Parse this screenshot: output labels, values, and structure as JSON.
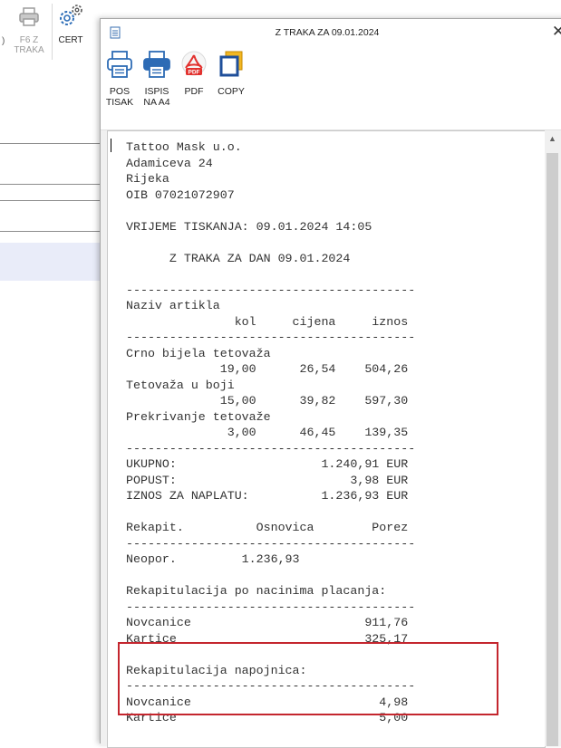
{
  "background_app": {
    "toolbar": {
      "cut_label": ")",
      "f6_label_line1": "F6 Z",
      "f6_label_line2": "TRAKA",
      "cert_label": "CERT"
    }
  },
  "window": {
    "title": "Z TRAKA ZA 09.01.2024",
    "close_glyph": "✕",
    "ribbon": {
      "pos_label_line1": "POS",
      "pos_label_line2": "TISAK",
      "ispis_label_line1": "ISPIS",
      "ispis_label_line2": "NA A4",
      "pdf_label": "PDF",
      "pdf_badge": "PDF",
      "copy_label": "COPY"
    }
  },
  "receipt": {
    "lines": [
      "Tattoo Mask u.o.",
      "Adamiceva 24",
      "Rijeka",
      "OIB 07021072907",
      "",
      "VRIJEME TISKANJA: 09.01.2024 14:05",
      "",
      "      Z TRAKA ZA DAN 09.01.2024",
      "",
      "----------------------------------------",
      "Naziv artikla",
      "               kol     cijena     iznos",
      "----------------------------------------",
      "Crno bijela tetovaža",
      "             19,00      26,54    504,26",
      "Tetovaža u boji",
      "             15,00      39,82    597,30",
      "Prekrivanje tetovaže",
      "              3,00      46,45    139,35",
      "----------------------------------------",
      "UKUPNO:                    1.240,91 EUR",
      "POPUST:                        3,98 EUR",
      "IZNOS ZA NAPLATU:          1.236,93 EUR",
      "",
      "Rekapit.          Osnovica        Porez",
      "----------------------------------------",
      "Neopor.         1.236,93",
      "",
      "Rekapitulacija po nacinima placanja:",
      "----------------------------------------",
      "Novcanice                        911,76",
      "Kartice                          325,17",
      "",
      "Rekapitulacija napojnica:",
      "----------------------------------------",
      "Novcanice                          4,98",
      "Kartice                            5,00"
    ]
  },
  "icons": {
    "title": "document-icon",
    "pos": "pos-printer-icon",
    "a4": "a4-printer-icon",
    "pdf": "pdf-icon",
    "copy": "copy-icon",
    "cert": "gear-icon",
    "f6": "printer-icon"
  },
  "colors": {
    "highlight": "#c4262e",
    "copy_icon": "#1f4f9a",
    "pdf_red": "#e2312e",
    "selection_band": "#e9ecf9"
  }
}
